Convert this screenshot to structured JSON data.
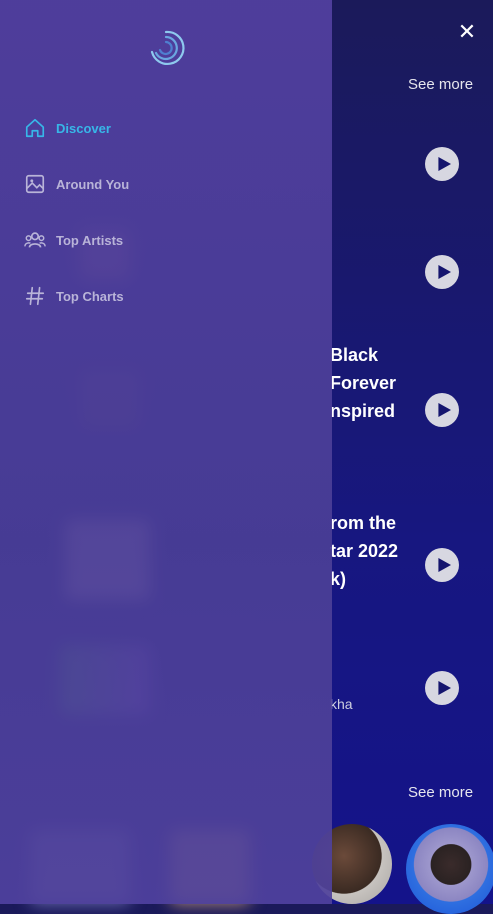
{
  "header": {
    "close_label": "✕"
  },
  "sections": [
    {
      "see_more": "See more"
    },
    {
      "see_more": "See more"
    }
  ],
  "songs": [
    {
      "title_lines": [
        "Black",
        "Forever",
        "nspired"
      ]
    },
    {
      "title_lines": [
        "rom the",
        "tar 2022",
        "k)"
      ]
    },
    {
      "subtitle": "kha"
    }
  ],
  "sidebar": {
    "items": [
      {
        "label": "Discover",
        "icon": "home-icon",
        "active": true
      },
      {
        "label": "Around You",
        "icon": "image-icon",
        "active": false
      },
      {
        "label": "Top Artists",
        "icon": "users-icon",
        "active": false
      },
      {
        "label": "Top Charts",
        "icon": "hash-icon",
        "active": false
      }
    ]
  },
  "colors": {
    "accent": "#37b7e8",
    "sidebar": "#5240a0",
    "background": "#171780"
  }
}
